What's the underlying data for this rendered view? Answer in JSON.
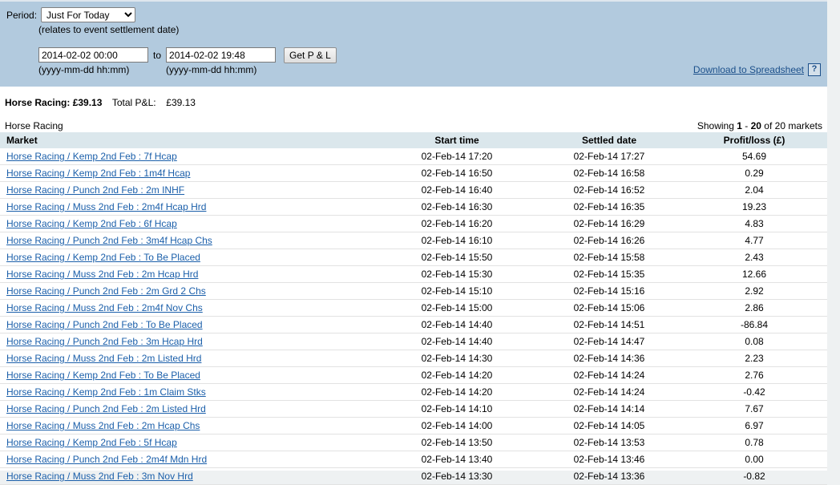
{
  "filter": {
    "period_label": "Period:",
    "period_value": "Just For Today",
    "period_options": [
      "Just For Today"
    ],
    "relates_hint": "(relates to event settlement date)",
    "date_from_value": "2014-02-02 00:00",
    "date_from_placeholder": "yyyy-mm-dd hh:mm",
    "date_from_format": "(yyyy-mm-dd hh:mm)",
    "to_label": "to",
    "date_to_value": "2014-02-02 19:48",
    "date_to_placeholder": "yyyy-mm-dd hh:mm",
    "date_to_format": "(yyyy-mm-dd hh:mm)",
    "get_pl_label": "Get P & L",
    "download_label": "Download to Spreadsheet",
    "help_label": "?",
    "panel_color": "#b2cade"
  },
  "summary": {
    "category": "Horse Racing:",
    "category_amount": "£39.13",
    "total_label": "Total P&L:",
    "total_amount": "£39.13"
  },
  "results": {
    "section_label": "Horse Racing",
    "showing_prefix": "Showing",
    "showing_from": "1",
    "showing_dash": "-",
    "showing_to": "20",
    "showing_suffix": "of 20 markets",
    "columns": [
      "Market",
      "Start time",
      "Settled date",
      "Profit/loss (£)"
    ],
    "rows": [
      {
        "market": "Horse Racing / Kemp 2nd Feb : 7f Hcap",
        "start": "02-Feb-14 17:20",
        "settled": "02-Feb-14 17:27",
        "pl": "54.69"
      },
      {
        "market": "Horse Racing / Kemp 2nd Feb : 1m4f Hcap",
        "start": "02-Feb-14 16:50",
        "settled": "02-Feb-14 16:58",
        "pl": "0.29"
      },
      {
        "market": "Horse Racing / Punch 2nd Feb : 2m INHF",
        "start": "02-Feb-14 16:40",
        "settled": "02-Feb-14 16:52",
        "pl": "2.04"
      },
      {
        "market": "Horse Racing / Muss 2nd Feb : 2m4f Hcap Hrd",
        "start": "02-Feb-14 16:30",
        "settled": "02-Feb-14 16:35",
        "pl": "19.23"
      },
      {
        "market": "Horse Racing / Kemp 2nd Feb : 6f Hcap",
        "start": "02-Feb-14 16:20",
        "settled": "02-Feb-14 16:29",
        "pl": "4.83"
      },
      {
        "market": "Horse Racing / Punch 2nd Feb : 3m4f Hcap Chs",
        "start": "02-Feb-14 16:10",
        "settled": "02-Feb-14 16:26",
        "pl": "4.77"
      },
      {
        "market": "Horse Racing / Kemp 2nd Feb : To Be Placed",
        "start": "02-Feb-14 15:50",
        "settled": "02-Feb-14 15:58",
        "pl": "2.43"
      },
      {
        "market": "Horse Racing / Muss 2nd Feb : 2m Hcap Hrd",
        "start": "02-Feb-14 15:30",
        "settled": "02-Feb-14 15:35",
        "pl": "12.66"
      },
      {
        "market": "Horse Racing / Punch 2nd Feb : 2m Grd 2 Chs",
        "start": "02-Feb-14 15:10",
        "settled": "02-Feb-14 15:16",
        "pl": "2.92"
      },
      {
        "market": "Horse Racing / Muss 2nd Feb : 2m4f Nov Chs",
        "start": "02-Feb-14 15:00",
        "settled": "02-Feb-14 15:06",
        "pl": "2.86"
      },
      {
        "market": "Horse Racing / Punch 2nd Feb : To Be Placed",
        "start": "02-Feb-14 14:40",
        "settled": "02-Feb-14 14:51",
        "pl": "-86.84"
      },
      {
        "market": "Horse Racing / Punch 2nd Feb : 3m Hcap Hrd",
        "start": "02-Feb-14 14:40",
        "settled": "02-Feb-14 14:47",
        "pl": "0.08"
      },
      {
        "market": "Horse Racing / Muss 2nd Feb : 2m Listed Hrd",
        "start": "02-Feb-14 14:30",
        "settled": "02-Feb-14 14:36",
        "pl": "2.23"
      },
      {
        "market": "Horse Racing / Kemp 2nd Feb : To Be Placed",
        "start": "02-Feb-14 14:20",
        "settled": "02-Feb-14 14:24",
        "pl": "2.76"
      },
      {
        "market": "Horse Racing / Kemp 2nd Feb : 1m Claim Stks",
        "start": "02-Feb-14 14:20",
        "settled": "02-Feb-14 14:24",
        "pl": "-0.42"
      },
      {
        "market": "Horse Racing / Punch 2nd Feb : 2m Listed Hrd",
        "start": "02-Feb-14 14:10",
        "settled": "02-Feb-14 14:14",
        "pl": "7.67"
      },
      {
        "market": "Horse Racing / Muss 2nd Feb : 2m Hcap Chs",
        "start": "02-Feb-14 14:00",
        "settled": "02-Feb-14 14:05",
        "pl": "6.97"
      },
      {
        "market": "Horse Racing / Kemp 2nd Feb : 5f Hcap",
        "start": "02-Feb-14 13:50",
        "settled": "02-Feb-14 13:53",
        "pl": "0.78"
      },
      {
        "market": "Horse Racing / Punch 2nd Feb : 2m4f Mdn Hrd",
        "start": "02-Feb-14 13:40",
        "settled": "02-Feb-14 13:46",
        "pl": "0.00"
      },
      {
        "market": "Horse Racing / Muss 2nd Feb : 3m Nov Hrd",
        "start": "02-Feb-14 13:30",
        "settled": "02-Feb-14 13:36",
        "pl": "-0.82"
      }
    ]
  }
}
